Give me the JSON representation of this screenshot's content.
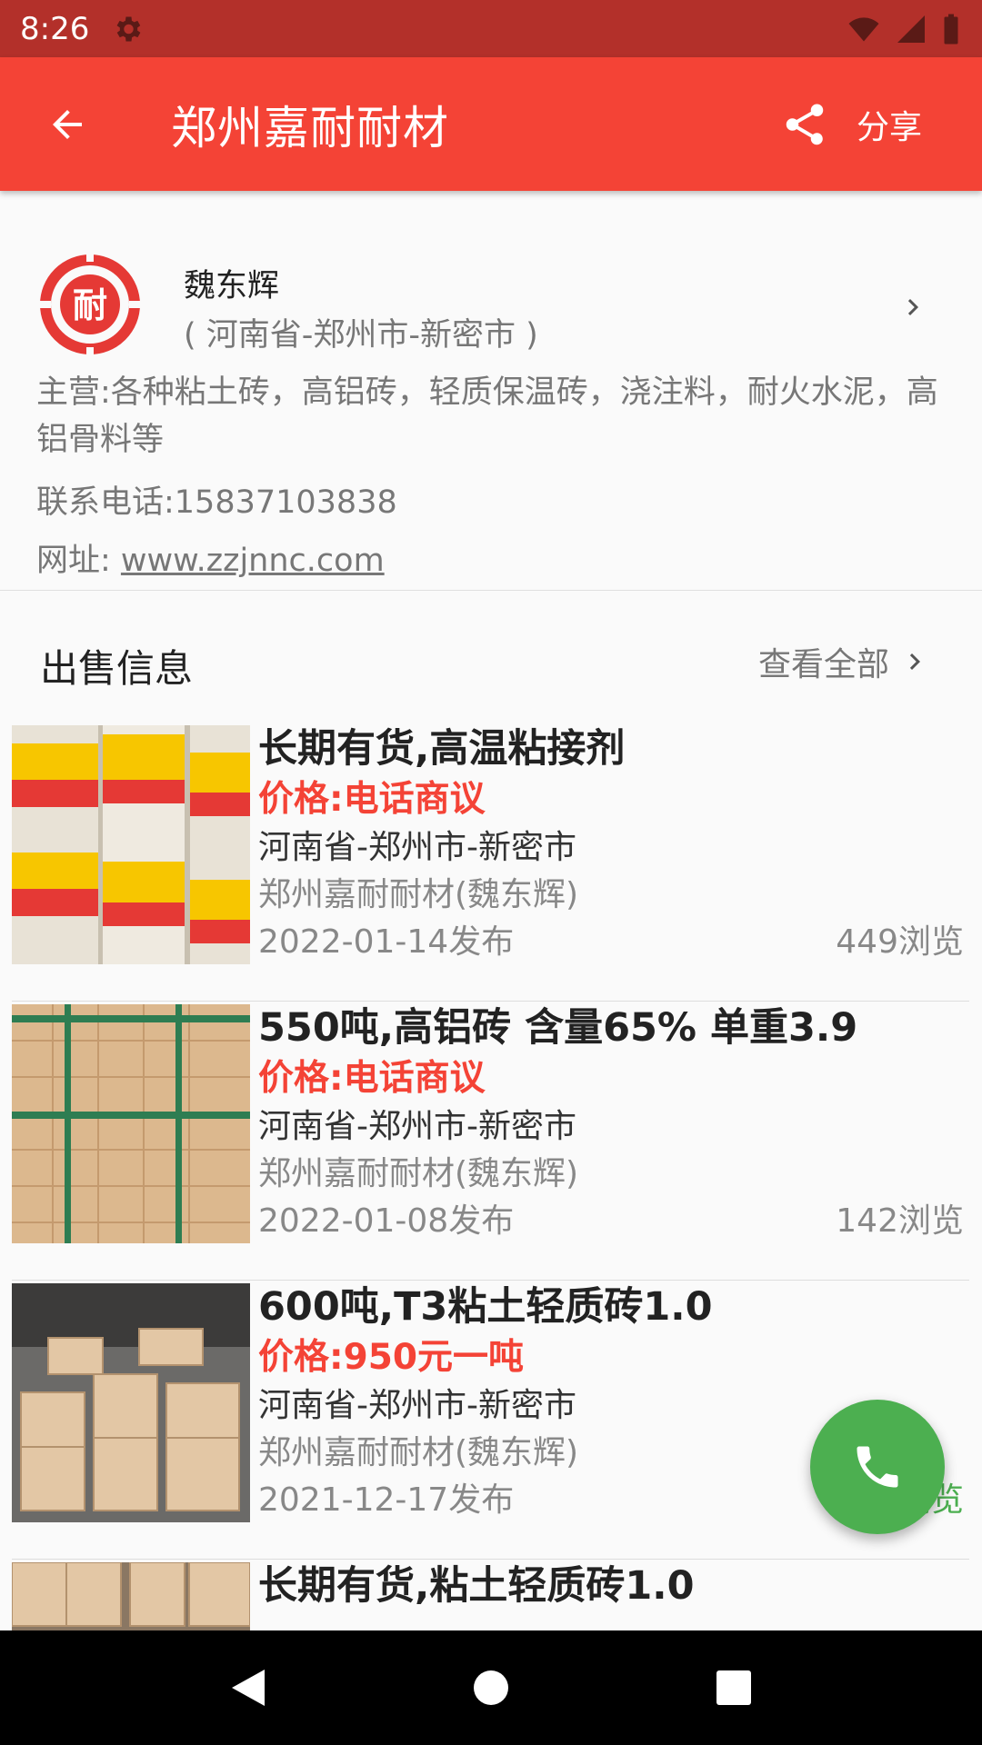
{
  "status_bar": {
    "time": "8:26"
  },
  "app_bar": {
    "title": "郑州嘉耐耐材",
    "share_label": "分享"
  },
  "company": {
    "logo_char": "耐",
    "contact_name": "魏东辉",
    "region": "( 河南省-郑州市-新密市 )",
    "main_business": "主营:各种粘土砖，高铝砖，轻质保温砖，浇注料，耐火水泥，高铝骨料等",
    "phone": "联系电话:15837103838",
    "website_label": "网址: ",
    "website_url": "www.zzjnnc.com"
  },
  "section": {
    "title": "出售信息",
    "view_all": "查看全部"
  },
  "listings": [
    {
      "title": "长期有货,高温粘接剂",
      "price": "价格:电话商议",
      "region": "河南省-郑州市-新密市",
      "seller": "郑州嘉耐耐材(魏东辉)",
      "date": "2022-01-14发布",
      "views": "449浏览",
      "image": "cans"
    },
    {
      "title": "550吨,高铝砖  含量65%  单重3.9",
      "price": "价格:电话商议",
      "region": "河南省-郑州市-新密市",
      "seller": "郑州嘉耐耐材(魏东辉)",
      "date": "2022-01-08发布",
      "views": "142浏览",
      "image": "brick-stack"
    },
    {
      "title": "600吨,T3粘土轻质砖1.0",
      "price": "价格:950元一吨",
      "region": "河南省-郑州市-新密市",
      "seller": "郑州嘉耐耐材(魏东辉)",
      "date": "2021-12-17发布",
      "views": "浏览",
      "image": "brick-pallet"
    },
    {
      "title": "长期有货,粘土轻质砖1.0",
      "image": "brick-pallet"
    }
  ],
  "colors": {
    "primary": "#f44336",
    "status_bar": "#b3302a",
    "fab": "#4caf50",
    "price": "#f44336"
  },
  "icons": [
    "settings-icon",
    "wifi-icon",
    "signal-icon",
    "battery-icon",
    "back-arrow-icon",
    "share-icon",
    "chevron-right-icon",
    "phone-icon",
    "nav-back-icon",
    "nav-home-icon",
    "nav-recents-icon"
  ]
}
